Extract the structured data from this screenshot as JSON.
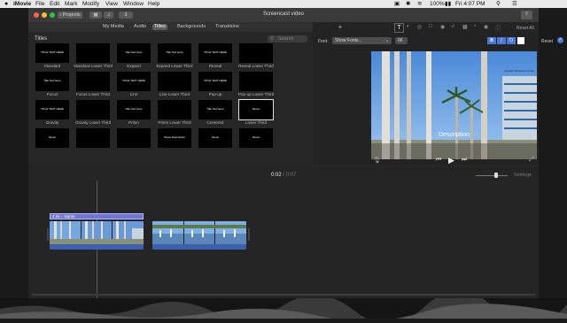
{
  "menubar": {
    "app": "iMovie",
    "items": [
      "File",
      "Edit",
      "Mark",
      "Modify",
      "View",
      "Window",
      "Help"
    ],
    "battery": "100%",
    "clock": "Fri 4:07 PM"
  },
  "titlebar": {
    "back_label": "Projects",
    "title": "Screencast video"
  },
  "tabs": [
    {
      "label": "My Media"
    },
    {
      "label": "Audio"
    },
    {
      "label": "Titles"
    },
    {
      "label": "Backgrounds"
    },
    {
      "label": "Transitions"
    }
  ],
  "active_tab": "Titles",
  "browser": {
    "heading": "Titles",
    "search_placeholder": "Search",
    "titles": [
      {
        "label": "Standard",
        "preview": "TITLE TEXT HERE"
      },
      {
        "label": "Standard Lower Third",
        "preview": ""
      },
      {
        "label": "Expand",
        "preview": "Title Text Here"
      },
      {
        "label": "Expand Lower Third",
        "preview": "Title Text Here"
      },
      {
        "label": "Reveal",
        "preview": "TITLE TEXT HERE"
      },
      {
        "label": "Reveal Lower Third",
        "preview": ""
      },
      {
        "label": "Focus",
        "preview": "Title Text Here"
      },
      {
        "label": "Focus Lower Third",
        "preview": ""
      },
      {
        "label": "Line",
        "preview": "TITLE TEXT HERE"
      },
      {
        "label": "Line Lower Third",
        "preview": ""
      },
      {
        "label": "Pop-up",
        "preview": "TITLE TEXT HERE"
      },
      {
        "label": "Pop-up Lower Third",
        "preview": ""
      },
      {
        "label": "Gravity",
        "preview": "TITLE TEXT HERE"
      },
      {
        "label": "Gravity Lower Third",
        "preview": ""
      },
      {
        "label": "Prism",
        "preview": "Title Text Here"
      },
      {
        "label": "Prism Lower Third",
        "preview": ""
      },
      {
        "label": "Centered",
        "preview": "Title Text Here"
      },
      {
        "label": "Lower Third",
        "preview": "Name"
      },
      {
        "label": "",
        "preview": "Name"
      },
      {
        "label": "",
        "preview": ""
      },
      {
        "label": "",
        "preview": ""
      },
      {
        "label": "",
        "preview": "Name Description"
      },
      {
        "label": "",
        "preview": "Name"
      },
      {
        "label": "",
        "preview": "Name"
      }
    ]
  },
  "viewer": {
    "reset_all": "Reset All",
    "font_label": "Font:",
    "font_value": "Show Fonts...",
    "font_size": "66",
    "reset": "Reset",
    "overlay_title": "Description",
    "building_sign": "Johnson Business Center"
  },
  "timeline": {
    "current_time": "0:02",
    "separator": "/",
    "total_time": "0:07",
    "settings": "Settings",
    "title_clip_label": "4.0s – Name"
  },
  "colors": {
    "accent_blue": "#4b78d6",
    "title_clip": "#6f74d8",
    "window_bg": "#262626"
  }
}
